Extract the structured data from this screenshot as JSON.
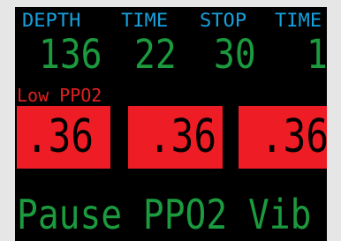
{
  "header": {
    "depth_label": "DEPTH",
    "time_label": "TIME",
    "stop_label": "STOP",
    "time2_label": "TIME"
  },
  "values": {
    "depth": "136",
    "time": "22",
    "stop": "30",
    "time2": "1"
  },
  "alert": {
    "label": "Low PPO2"
  },
  "ppo2_sensors": [
    ".36",
    ".36",
    ".36"
  ],
  "menu": {
    "label": "Pause PPO2 Vib"
  },
  "colors": {
    "header": "#16a0dc",
    "value": "#1b9a3e",
    "alert": "#e02020",
    "sensor_bg": "#ee1c24",
    "screen_bg": "#000000"
  }
}
